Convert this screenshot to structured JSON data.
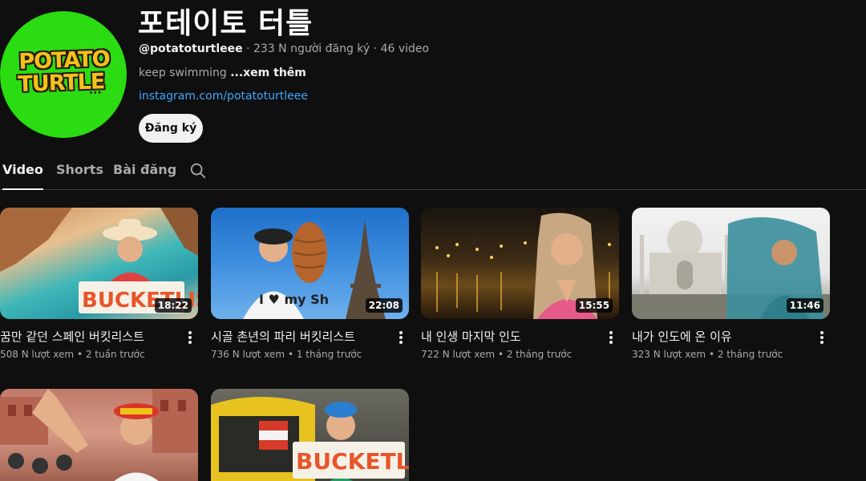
{
  "channel": {
    "title": "포테이토 터틀",
    "handle": "@potatoturtleee",
    "subscribers": "233 N người đăng ký",
    "video_count": "46 video",
    "separator": " · ",
    "description": "keep swimming",
    "more_label": "...xem thêm",
    "link": "instagram.com/potatoturtleee",
    "subscribe_label": "Đăng ký",
    "avatar_logo_line1": "POTATO",
    "avatar_logo_line2": "TURTLE",
    "avatar_logo_dots": "...",
    "avatar_bg": "#2bdc12"
  },
  "tabs": [
    {
      "label": "Video",
      "active": true
    },
    {
      "label": "Shorts",
      "active": false
    },
    {
      "label": "Bài đăng",
      "active": false
    }
  ],
  "videos": [
    {
      "title": "꿈만 같던 스페인 버킷리스트",
      "views": "508 N lượt xem",
      "age": "2 tuần trước",
      "duration": "18:22",
      "sign": "BUCKETLIST"
    },
    {
      "title": "시골 촌년의 파리 버킷리스트",
      "views": "736 N lượt xem",
      "age": "1 tháng trước",
      "duration": "22:08",
      "shirt": "I ♥ my Sh"
    },
    {
      "title": "내 인생 마지막 인도",
      "views": "722 N lượt xem",
      "age": "2 tháng trước",
      "duration": "15:55"
    },
    {
      "title": "내가 인도에 온 이유",
      "views": "323 N lượt xem",
      "age": "2 tháng trước",
      "duration": "11:46"
    },
    {
      "title": "",
      "views": "",
      "age": "",
      "duration": ""
    },
    {
      "title": "",
      "views": "",
      "age": "",
      "duration": "",
      "sign": "BUCKETLIST"
    }
  ],
  "colors": {
    "background": "#0f0f0f",
    "link": "#3ea6ff",
    "text_secondary": "#aaaaaa"
  }
}
